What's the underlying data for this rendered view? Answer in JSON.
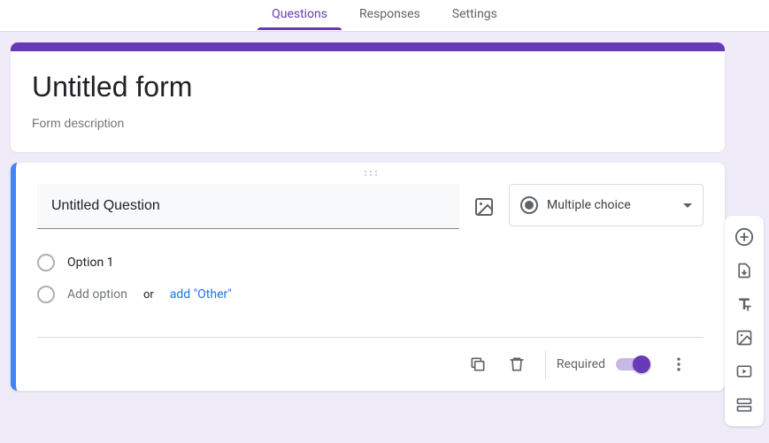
{
  "tabs": {
    "questions": "Questions",
    "responses": "Responses",
    "settings": "Settings"
  },
  "form": {
    "title": "Untitled form",
    "description_placeholder": "Form description"
  },
  "question": {
    "title": "Untitled Question",
    "type_label": "Multiple choice",
    "options": [
      "Option 1"
    ],
    "add_option_label": "Add option",
    "or_label": "or",
    "add_other_label": "add \"Other\""
  },
  "footer": {
    "required_label": "Required",
    "required_value": true
  }
}
